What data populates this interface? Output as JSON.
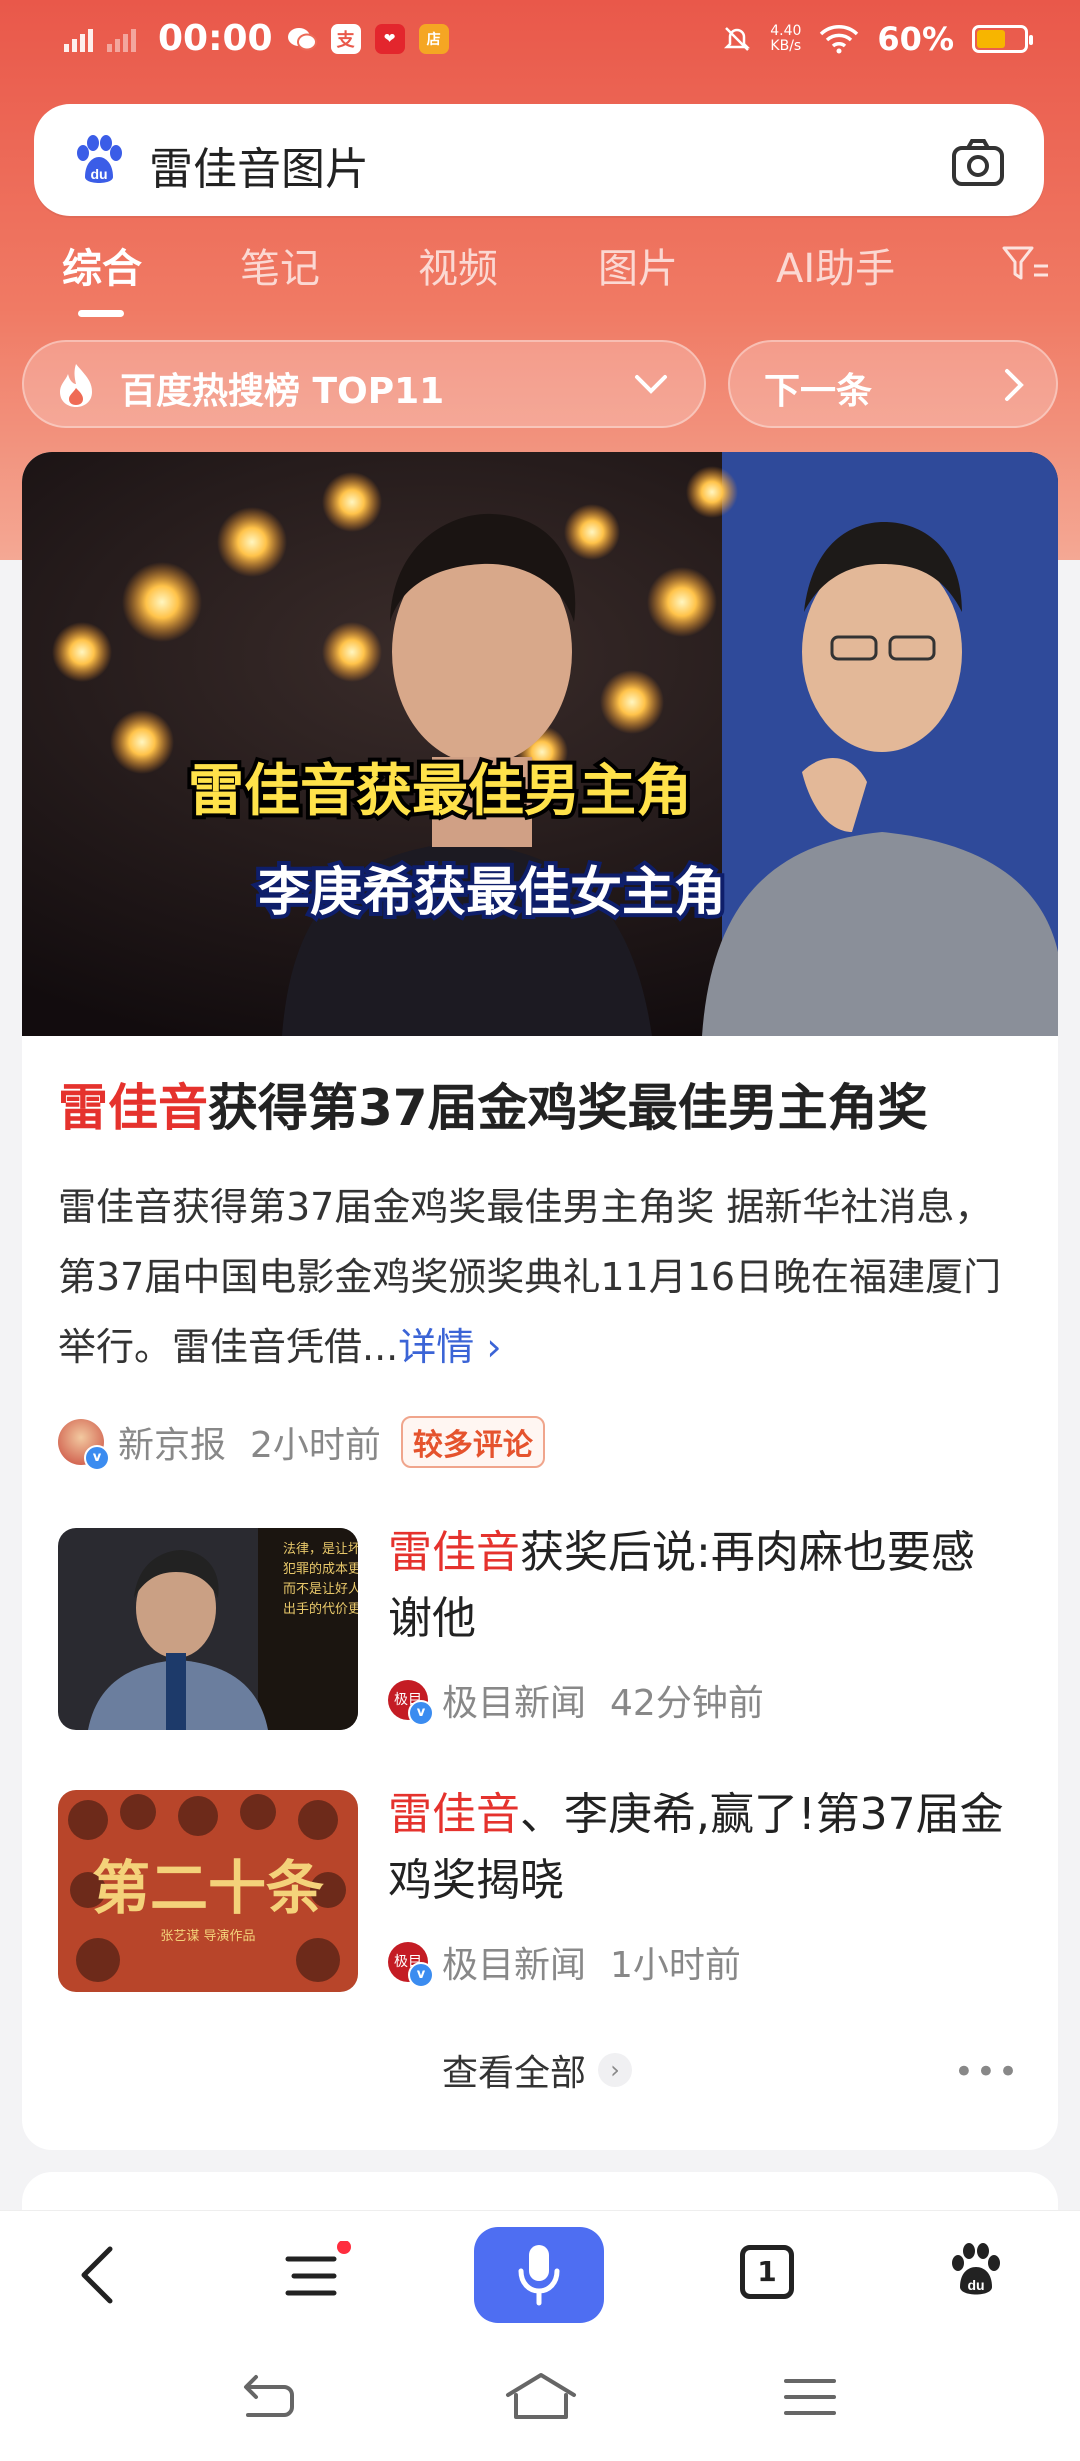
{
  "status_bar": {
    "time": "00:00",
    "network_speed": "4.40",
    "network_unit": "KB/s",
    "battery_percent": "60%",
    "battery_level": 0.6,
    "app_icons": [
      "wechat-icon",
      "alipay-icon",
      "app-icon-1",
      "app-icon-2"
    ]
  },
  "search": {
    "query": "雷佳音图片"
  },
  "tabs": [
    {
      "label": "综合",
      "active": true
    },
    {
      "label": "笔记",
      "active": false
    },
    {
      "label": "视频",
      "active": false
    },
    {
      "label": "图片",
      "active": false
    },
    {
      "label": "AI助手",
      "active": false
    }
  ],
  "hot": {
    "label": "百度热搜榜 TOP11",
    "next_label": "下一条"
  },
  "main_card": {
    "hero_caption_1": "雷佳音获最佳男主角",
    "hero_caption_2": "李庚希获最佳女主角",
    "title_highlight": "雷佳音",
    "title_rest": "获得第37届金鸡奖最佳男主角奖",
    "summary": "雷佳音获得第37届金鸡奖最佳男主角奖 据新华社消息，第37届中国电影金鸡奖颁奖典礼11月16日晚在福建厦门举行。雷佳音凭借...",
    "more_label": "详情 ›",
    "source": "新京报",
    "time": "2小时前",
    "tag": "较多评论"
  },
  "news": [
    {
      "title_highlight": "雷佳音",
      "title_rest": "获奖后说:再肉麻也要感谢他",
      "source": "极目新闻",
      "time": "42分钟前",
      "thumb_text": "法律，是让坏人犯罪的成本更高 而不是让好人出手的代价更大"
    },
    {
      "title_highlight": "雷佳音",
      "title_rest": "、李庚希,赢了!第37届金鸡奖揭晓",
      "source": "极目新闻",
      "time": "1小时前",
      "thumb_text": "第二十条",
      "thumb_sub": "张艺谋 导演作品"
    }
  ],
  "view_all": "查看全部",
  "more_dots": "•••",
  "bottom_bar": {
    "tab_count": "1",
    "menu_has_dot": true
  },
  "colors": {
    "accent_red": "#e5322d",
    "mic_blue": "#4e6ef2",
    "link_blue": "#3b64d6",
    "header_gradient_top": "#e9584a"
  }
}
